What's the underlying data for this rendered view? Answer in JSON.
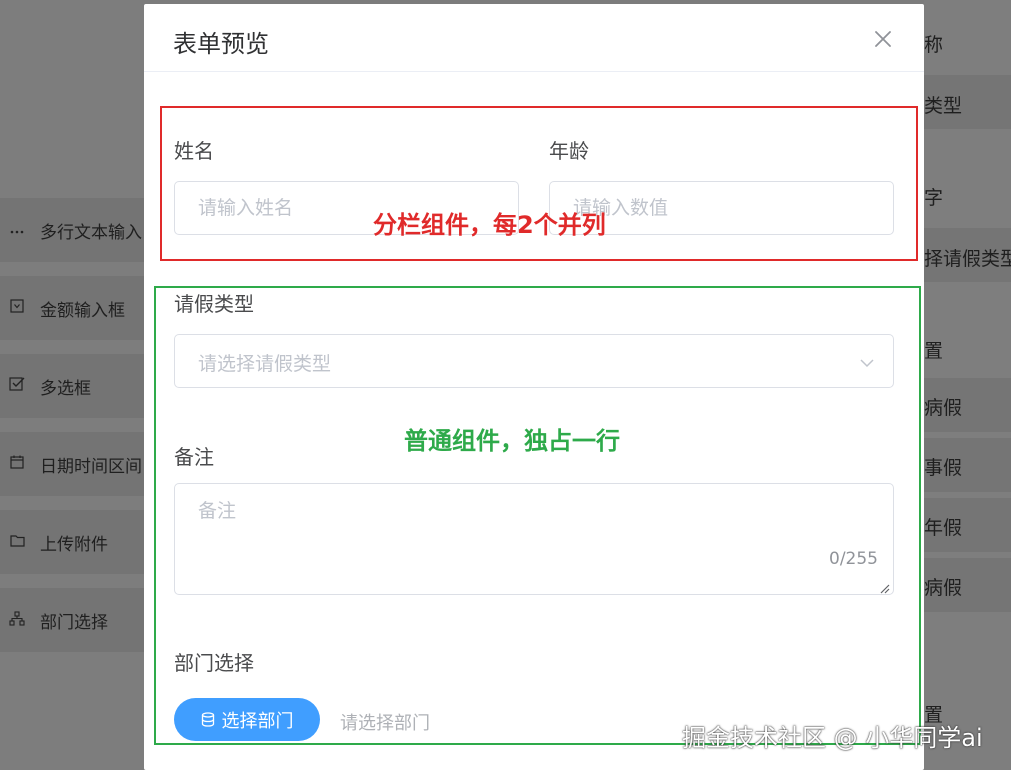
{
  "background": {
    "palette": [
      {
        "icon": "more-icon",
        "label": "多行文本输入"
      },
      {
        "icon": "currency-icon",
        "label": "金额输入框"
      },
      {
        "icon": "checkbox-icon",
        "label": "多选框"
      },
      {
        "icon": "calendar-icon",
        "label": "日期时间区间"
      },
      {
        "icon": "folder-icon",
        "label": "上传附件"
      },
      {
        "icon": "org-tree-icon",
        "label": "部门选择"
      }
    ],
    "right_items": [
      "称",
      "类型",
      "字",
      "择请假类型",
      "置",
      "病假",
      "事假",
      "年假",
      "病假",
      "置"
    ]
  },
  "dialog": {
    "title": "表单预览",
    "name_field": {
      "label": "姓名",
      "placeholder": "请输入姓名",
      "value": ""
    },
    "age_field": {
      "label": "年龄",
      "placeholder": "请输入数值",
      "value": ""
    },
    "leave_type_field": {
      "label": "请假类型",
      "placeholder": "请选择请假类型"
    },
    "remark_field": {
      "label": "备注",
      "placeholder": "备注",
      "counter": "0/255"
    },
    "dept_field": {
      "label": "部门选择",
      "button_label": "选择部门",
      "hint": "请选择部门"
    }
  },
  "annotations": {
    "columns_note": "分栏组件，每2个并列",
    "row_note": "普通组件，独占一行"
  },
  "watermark": "掘金技术社区 @ 小华同学ai",
  "colors": {
    "primary": "#409eff",
    "annotation_red": "#e02a2a",
    "annotation_green": "#2eaa4a",
    "overlay": "#7c7c7c"
  }
}
